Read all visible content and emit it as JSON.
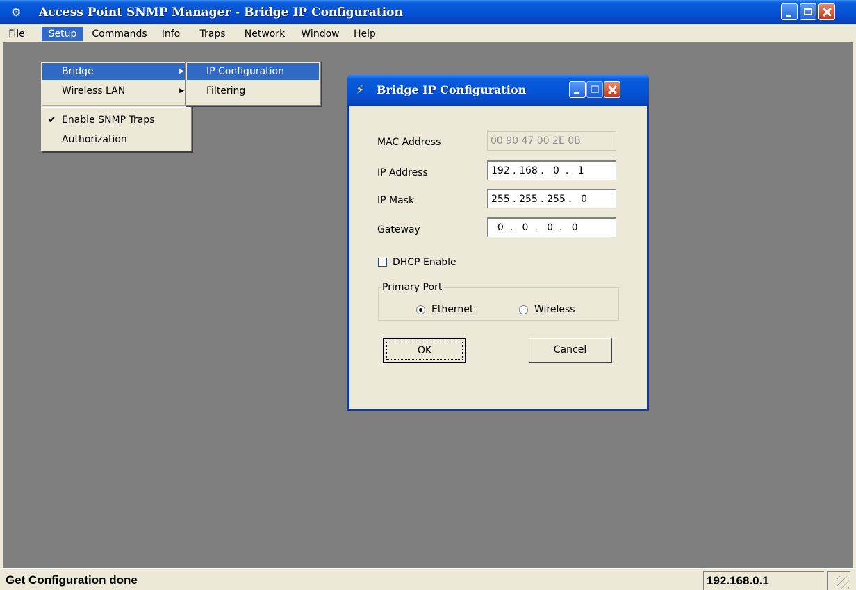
{
  "window": {
    "title": "Access Point SNMP Manager - Bridge IP Configuration",
    "icon": "network-app-icon"
  },
  "menubar": {
    "items": [
      "File",
      "Setup",
      "Commands",
      "Info",
      "Traps",
      "Network",
      "Window",
      "Help"
    ],
    "active": "Setup"
  },
  "setup_menu": {
    "items": [
      "Bridge",
      "Wireless LAN",
      "Enable SNMP Traps",
      "Authorization"
    ],
    "highlighted": "Bridge",
    "checked": "Enable SNMP Traps"
  },
  "bridge_submenu": {
    "items": [
      "IP Configuration",
      "Filtering"
    ],
    "highlighted": "IP Configuration"
  },
  "dialog": {
    "title": "Bridge IP Configuration",
    "mac_label": "MAC Address",
    "mac_value": "00 90 47 00 2E 0B",
    "ip_label": "IP Address",
    "ip_value": "192 . 168 .   0  .   1",
    "mask_label": "IP Mask",
    "mask_value": "255 . 255 . 255 .   0",
    "gateway_label": "Gateway",
    "gateway_value": "  0  .   0  .   0  .   0",
    "dhcp_label": "DHCP Enable",
    "dhcp_checked": false,
    "primary_port_label": "Primary Port",
    "ethernet_label": "Ethernet",
    "wireless_label": "Wireless",
    "primary_port_selected": "Ethernet",
    "ok_label": "OK",
    "cancel_label": "Cancel"
  },
  "statusbar": {
    "message": "Get Configuration done",
    "ip": "192.168.0.1"
  },
  "colors": {
    "titlebar": "#0553d6",
    "menu_highlight": "#316ac5",
    "face": "#ece9d8",
    "workspace": "#7f7f7f",
    "close_button": "#c6371a"
  }
}
